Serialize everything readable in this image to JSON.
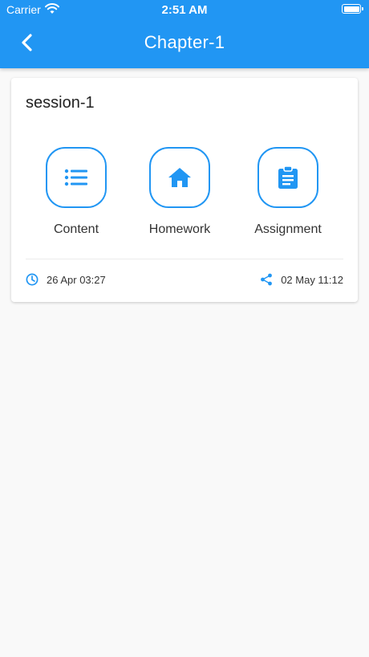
{
  "status_bar": {
    "carrier": "Carrier",
    "time": "2:51 AM"
  },
  "app_bar": {
    "title": "Chapter-1"
  },
  "session": {
    "title": "session-1",
    "actions": [
      {
        "label": "Content",
        "icon": "list-icon"
      },
      {
        "label": "Homework",
        "icon": "home-icon"
      },
      {
        "label": "Assignment",
        "icon": "clipboard-icon"
      }
    ],
    "created": "26 Apr 03:27",
    "shared": "02 May 11:12"
  },
  "colors": {
    "primary": "#2196f3",
    "background": "#f9f9f9",
    "card": "#ffffff"
  }
}
